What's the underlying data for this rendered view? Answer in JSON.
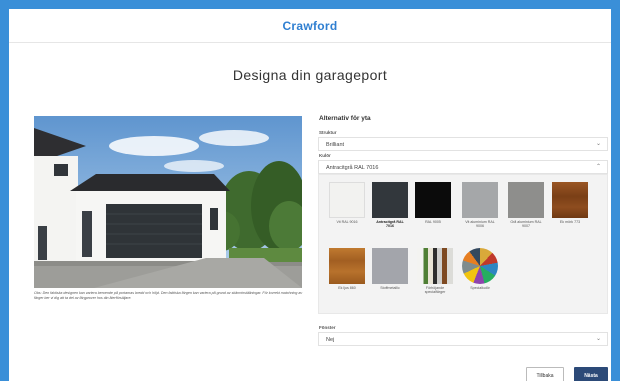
{
  "brand": {
    "logo": "Crawford"
  },
  "page": {
    "title": "Designa din garageport"
  },
  "image": {
    "caption": "Obs: Den faktiska designen kan variera beroende på portarnas bredd och höjd. Den faktiska färgen kan variera på grund av skärminställningar. För korrekt matchning av färger ber vi dig att ta del av färgprover hos din återförsäljare."
  },
  "options": {
    "heading": "Alternativ för yta",
    "struktur": {
      "label": "Struktur",
      "value": "Brilliant"
    },
    "kulor": {
      "label": "Kulör",
      "value": "Antracitgrå RAL 7016"
    },
    "swatches": [
      {
        "name": "Vit RAL 9016",
        "color": "#f2f2f0",
        "selected": false
      },
      {
        "name": "Antracitgrå RAL 7016",
        "color": "#32373c",
        "selected": true
      },
      {
        "name": "RAL 9005",
        "color": "#0b0b0b",
        "selected": false
      },
      {
        "name": "Vit aluminium RAL 9006",
        "color": "#a5a7a9",
        "selected": false
      },
      {
        "name": "Grå aluminium RAL 9007",
        "color": "#8e8e8c",
        "selected": false
      },
      {
        "name": "Ek mörk 773",
        "color": "#8a4a1c",
        "selected": false
      },
      {
        "name": "Ek ljus 860",
        "color": "#b06a28",
        "selected": false
      },
      {
        "name": "Stoffmetallic",
        "color": "#a3a5ab",
        "selected": false
      },
      {
        "name": "Förhöjande specialfärger",
        "color": "#5a8a3a",
        "selected": false
      },
      {
        "name": "Specialkulör",
        "color": "#d9a93a",
        "selected": false
      }
    ],
    "fonster": {
      "label": "Fönster",
      "value": "Nej"
    }
  },
  "buttons": {
    "back": "Tillbaka",
    "next": "Nästa"
  }
}
